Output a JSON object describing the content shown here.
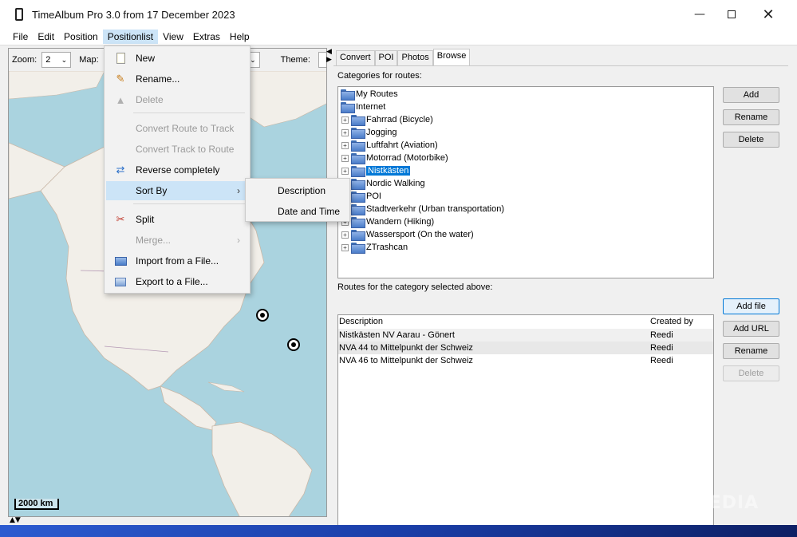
{
  "window": {
    "title": "TimeAlbum Pro 3.0 from 17 December 2023"
  },
  "menubar": {
    "items": [
      "File",
      "Edit",
      "Position",
      "Positionlist",
      "View",
      "Extras",
      "Help"
    ]
  },
  "toolbar": {
    "zoom_label": "Zoom:",
    "zoom_value": "2",
    "map_label": "Map:",
    "theme_label": "Theme:"
  },
  "map": {
    "scale_label": "2000 km"
  },
  "tabs": [
    "Convert",
    "POI",
    "Photos",
    "Browse"
  ],
  "browse": {
    "categories_label": "Categories for routes:",
    "tree": [
      {
        "label": "My Routes",
        "level": 0,
        "expander": false
      },
      {
        "label": "Internet",
        "level": 0,
        "expander": false
      },
      {
        "label": "Fahrrad (Bicycle)",
        "level": 1,
        "expander": true
      },
      {
        "label": "Jogging",
        "level": 1,
        "expander": true
      },
      {
        "label": "Luftfahrt (Aviation)",
        "level": 1,
        "expander": true
      },
      {
        "label": "Motorrad (Motorbike)",
        "level": 1,
        "expander": true
      },
      {
        "label": "Nistkästen",
        "level": 1,
        "expander": true,
        "selected": true
      },
      {
        "label": "Nordic Walking",
        "level": 1,
        "expander": true
      },
      {
        "label": "POI",
        "level": 1,
        "expander": true
      },
      {
        "label": "Stadtverkehr (Urban transportation)",
        "level": 1,
        "expander": true
      },
      {
        "label": "Wandern (Hiking)",
        "level": 1,
        "expander": true
      },
      {
        "label": "Wassersport (On the water)",
        "level": 1,
        "expander": true
      },
      {
        "label": "ZTrashcan",
        "level": 1,
        "expander": true
      }
    ],
    "category_buttons": {
      "add": "Add",
      "rename": "Rename",
      "delete": "Delete"
    },
    "routes_label": "Routes for the category selected above:",
    "routes_columns": {
      "description": "Description",
      "created_by": "Created by"
    },
    "routes": [
      {
        "description": "Nistkästen NV Aarau - Gönert",
        "created_by": "Reedi"
      },
      {
        "description": "NVA 44 to Mittelpunkt der Schweiz",
        "created_by": "Reedi"
      },
      {
        "description": "NVA 46 to Mittelpunkt der Schweiz",
        "created_by": "Reedi"
      }
    ],
    "route_buttons": {
      "add_file": "Add file",
      "add_url": "Add URL",
      "rename": "Rename",
      "delete": "Delete"
    }
  },
  "positionlist_menu": {
    "new": "New",
    "rename": "Rename...",
    "delete": "Delete",
    "convert_route": "Convert Route to Track",
    "convert_track": "Convert Track to Route",
    "reverse": "Reverse completely",
    "sort_by": "Sort By",
    "split": "Split",
    "merge": "Merge...",
    "import": "Import from a File...",
    "export": "Export to a File..."
  },
  "sort_submenu": {
    "description": "Description",
    "date_time": "Date and Time"
  },
  "watermark": "SOFTPEDIA"
}
